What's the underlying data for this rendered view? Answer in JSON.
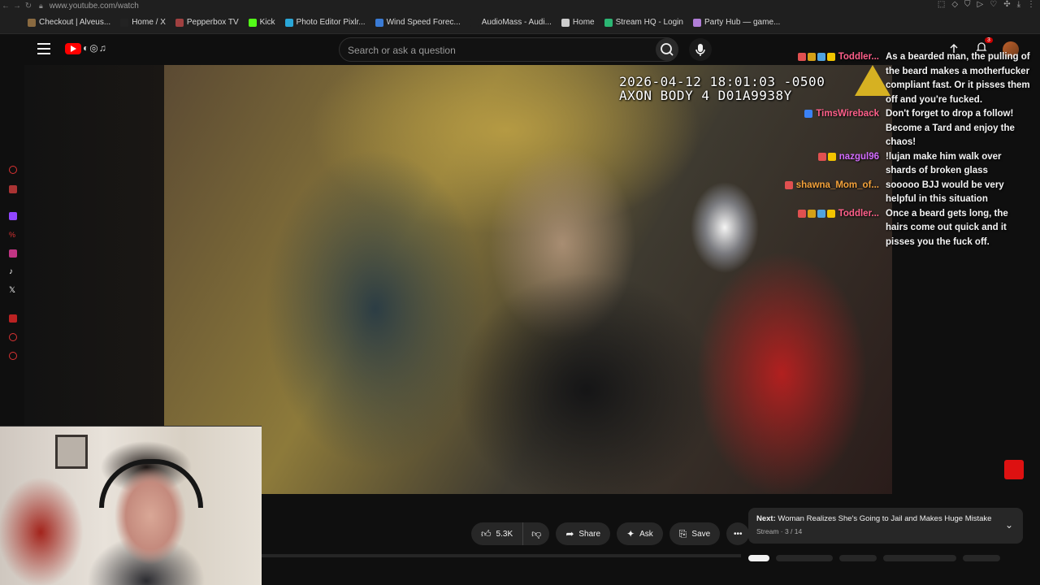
{
  "browser": {
    "url": "www.youtube.com/watch",
    "bookmarks": [
      {
        "label": "Checkout | Alveus...",
        "color": "#8a6a40"
      },
      {
        "label": "Home / X",
        "color": "#222222"
      },
      {
        "label": "Pepperbox TV",
        "color": "#a04040"
      },
      {
        "label": "Kick",
        "color": "#53fc18"
      },
      {
        "label": "Photo Editor Pixlr...",
        "color": "#2aa7d8"
      },
      {
        "label": "Wind Speed Forec...",
        "color": "#3a7bd5"
      },
      {
        "label": "AudioMass - Audi...",
        "color": "#1f1f1f"
      },
      {
        "label": "Home",
        "color": "#cccccc"
      },
      {
        "label": "Stream HQ - Login",
        "color": "#2bb673"
      },
      {
        "label": "Party Hub — game...",
        "color": "#b07dd6"
      }
    ]
  },
  "youtube": {
    "search_placeholder": "Search or ask a question",
    "notification_count": "3"
  },
  "video": {
    "timestamp_line1": "2026-04-12 18:01:03 -0500",
    "timestamp_line2": "AXON BODY 4 D01A9938Y"
  },
  "chat": [
    {
      "user": "Toddler...",
      "color": "#ff5f8a",
      "badges": [
        "#e05050",
        "#d4a017",
        "#4fa3e0",
        "#f2c400"
      ],
      "text": "As a bearded man, the pulling of the beard makes a motherfucker compliant fast. Or it pisses them off and you're fucked."
    },
    {
      "user": "TimsWireback",
      "color": "#ff5f8a",
      "badges": [
        "#3b82f6"
      ],
      "text": "Don't forget to drop a follow! Become a Tard and enjoy the chaos!"
    },
    {
      "user": "nazgul96",
      "color": "#d36bff",
      "badges": [
        "#e05050",
        "#f2c400"
      ],
      "text": "!lujan make him walk over shards of broken glass"
    },
    {
      "user": "shawna_Mom_of...",
      "color": "#f4a23a",
      "badges": [
        "#e05050"
      ],
      "text": "sooooo BJJ would be very helpful in this situation"
    },
    {
      "user": "Toddler...",
      "color": "#ff5f8a",
      "badges": [
        "#e05050",
        "#d4a017",
        "#4fa3e0",
        "#f2c400"
      ],
      "text": "Once a beard gets long, the hairs come out quick and it pisses you the fuck off."
    }
  ],
  "actions": {
    "like_count": "5.3K",
    "share_label": "Share",
    "ask_label": "Ask",
    "save_label": "Save"
  },
  "next": {
    "prefix": "Next:",
    "title": "Woman Realizes She's Going to Jail and Makes Huge Mistake",
    "subtitle": "Stream · 3 / 14"
  }
}
